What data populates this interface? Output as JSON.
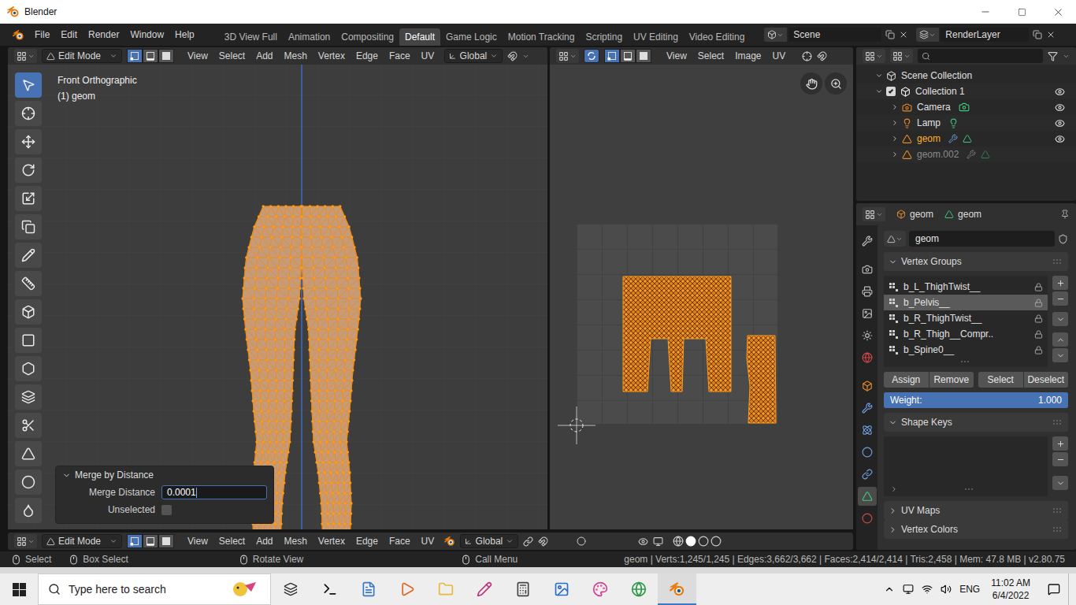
{
  "window": {
    "title": "Blender"
  },
  "menubar": [
    "File",
    "Edit",
    "Render",
    "Window",
    "Help"
  ],
  "workspaces": [
    {
      "label": "3D View Full",
      "selected": false
    },
    {
      "label": "Animation",
      "selected": false
    },
    {
      "label": "Compositing",
      "selected": false
    },
    {
      "label": "Default",
      "selected": true
    },
    {
      "label": "Game Logic",
      "selected": false
    },
    {
      "label": "Motion Tracking",
      "selected": false
    },
    {
      "label": "Scripting",
      "selected": false
    },
    {
      "label": "UV Editing",
      "selected": false
    },
    {
      "label": "Video Editing",
      "selected": false
    }
  ],
  "scene": "Scene",
  "view_layer": "RenderLayer",
  "viewport": {
    "mode": "Edit Mode",
    "select_modes": [
      {
        "kind": "vertex",
        "selected": true
      },
      {
        "kind": "edge",
        "selected": false
      },
      {
        "kind": "face",
        "selected": false
      }
    ],
    "menus": [
      "View",
      "Select",
      "Add",
      "Mesh",
      "Vertex",
      "Edge",
      "Face",
      "UV"
    ],
    "orientation": "Global",
    "view_name": "Front Orthographic",
    "object_label": "(1) geom",
    "tools": [
      {
        "kind": "select-box",
        "selected": true
      },
      {
        "kind": "cursor",
        "selected": false
      },
      {
        "kind": "move",
        "selected": false
      },
      {
        "kind": "rotate",
        "selected": false
      },
      {
        "kind": "scale",
        "selected": false
      },
      {
        "kind": "transform",
        "selected": false
      },
      {
        "kind": "annotate",
        "selected": false
      },
      {
        "kind": "measure",
        "selected": false
      },
      {
        "kind": "extrude",
        "selected": false
      },
      {
        "kind": "inset",
        "selected": false
      },
      {
        "kind": "bevel",
        "selected": false
      },
      {
        "kind": "loop-cut",
        "selected": false
      },
      {
        "kind": "knife",
        "selected": false
      },
      {
        "kind": "poly-build",
        "selected": false
      },
      {
        "kind": "spin",
        "selected": false
      },
      {
        "kind": "smooth",
        "selected": false
      }
    ]
  },
  "operator_panel": {
    "title": "Merge by Distance",
    "expanded": true,
    "fields": [
      {
        "kind": "number",
        "label": "Merge Distance",
        "value": "0.0001",
        "editing": true,
        "checked": false
      },
      {
        "kind": "checkbox",
        "label": "Unselected",
        "value": "",
        "editing": false,
        "checked": false
      }
    ]
  },
  "uv_editor": {
    "select_modes": [
      {
        "kind": "sync",
        "selected": true
      },
      {
        "kind": "vertex",
        "selected": true
      },
      {
        "kind": "edge",
        "selected": false
      },
      {
        "kind": "face",
        "selected": false
      }
    ],
    "menus": [
      "View",
      "Select",
      "Image",
      "UV"
    ]
  },
  "outliner": {
    "items": [
      {
        "label": "Scene Collection",
        "kind": "scene",
        "depth": 0,
        "expanded": true,
        "checked": false,
        "visible": false,
        "active": false,
        "dimmed": false
      },
      {
        "label": "Collection 1",
        "kind": "collection",
        "depth": 0,
        "expanded": true,
        "checked": true,
        "visible": true,
        "active": false,
        "dimmed": false
      },
      {
        "label": "Camera",
        "kind": "camera",
        "depth": 1,
        "expanded": false,
        "checked": false,
        "visible": true,
        "active": false,
        "dimmed": false
      },
      {
        "label": "Lamp",
        "kind": "lamp",
        "depth": 1,
        "expanded": false,
        "checked": false,
        "visible": true,
        "active": false,
        "dimmed": false
      },
      {
        "label": "geom",
        "kind": "mesh",
        "depth": 1,
        "expanded": false,
        "checked": false,
        "visible": true,
        "active": true,
        "dimmed": false
      },
      {
        "label": "geom.002",
        "kind": "mesh",
        "depth": 1,
        "expanded": false,
        "checked": false,
        "visible": false,
        "active": false,
        "dimmed": true
      }
    ]
  },
  "properties": {
    "context": [
      "geom",
      "geom"
    ],
    "data_name": "geom",
    "tabs": [
      {
        "kind": "tool",
        "selected": false
      },
      {
        "kind": "render",
        "selected": false
      },
      {
        "kind": "output",
        "selected": false
      },
      {
        "kind": "view-layer",
        "selected": false
      },
      {
        "kind": "scene",
        "selected": false
      },
      {
        "kind": "world",
        "selected": false
      },
      {
        "kind": "object",
        "selected": false
      },
      {
        "kind": "modifiers",
        "selected": false
      },
      {
        "kind": "particles",
        "selected": false
      },
      {
        "kind": "physics",
        "selected": false
      },
      {
        "kind": "constraints",
        "selected": false
      },
      {
        "kind": "data",
        "selected": true
      },
      {
        "kind": "material",
        "selected": false
      }
    ],
    "vertex_groups": {
      "title": "Vertex Groups",
      "expanded": true,
      "items": [
        {
          "label": "b_L_ThighTwist__",
          "selected": false
        },
        {
          "label": "b_Pelvis__",
          "selected": true
        },
        {
          "label": "b_R_ThighTwist__",
          "selected": false
        },
        {
          "label": "b_R_Thigh__Compr..",
          "selected": false
        },
        {
          "label": "b_Spine0__",
          "selected": false
        }
      ],
      "buttons": [
        "Assign",
        "Remove",
        "Select",
        "Deselect"
      ],
      "weight": {
        "label": "Weight:",
        "value": "1.000",
        "level": 1
      }
    },
    "shape_keys": {
      "title": "Shape Keys",
      "expanded": true
    },
    "sections": [
      {
        "title": "UV Maps",
        "expanded": false
      },
      {
        "title": "Vertex Colors",
        "expanded": false
      }
    ]
  },
  "bottom_header": {
    "mode": "Edit Mode",
    "select_modes": [
      {
        "kind": "vertex",
        "selected": true
      },
      {
        "kind": "edge",
        "selected": false
      },
      {
        "kind": "face",
        "selected": false
      }
    ],
    "menus": [
      "View",
      "Select",
      "Add",
      "Mesh",
      "Vertex",
      "Edge",
      "Face",
      "UV"
    ],
    "orientation": "Global"
  },
  "status_bar": {
    "hints": [
      {
        "kind": "left-click",
        "label": "Select"
      },
      {
        "kind": "left-drag",
        "label": "Box Select"
      },
      {
        "kind": "middle-drag",
        "label": "Rotate View"
      },
      {
        "kind": "right-click",
        "label": "Call Menu"
      }
    ],
    "stats": "geom | Verts:1,245/1,245 | Edges:3,662/3,662 | Faces:2,414/2,414 | Tris:2,458 | Mem: 47.8 MB | v2.80.75"
  },
  "taskbar": {
    "search_placeholder": "Type here to search",
    "apps": [
      {
        "kind": "terminal",
        "active": false
      },
      {
        "kind": "notepad",
        "active": false
      },
      {
        "kind": "media",
        "active": false
      },
      {
        "kind": "explorer",
        "active": false
      },
      {
        "kind": "sketch",
        "active": false
      },
      {
        "kind": "calculator",
        "active": false
      },
      {
        "kind": "photos",
        "active": false
      },
      {
        "kind": "paint",
        "active": false
      },
      {
        "kind": "chrome",
        "active": false
      },
      {
        "kind": "blender",
        "active": true
      }
    ],
    "language": "ENG",
    "time": "11:02 AM",
    "date": "6/4/2022"
  }
}
